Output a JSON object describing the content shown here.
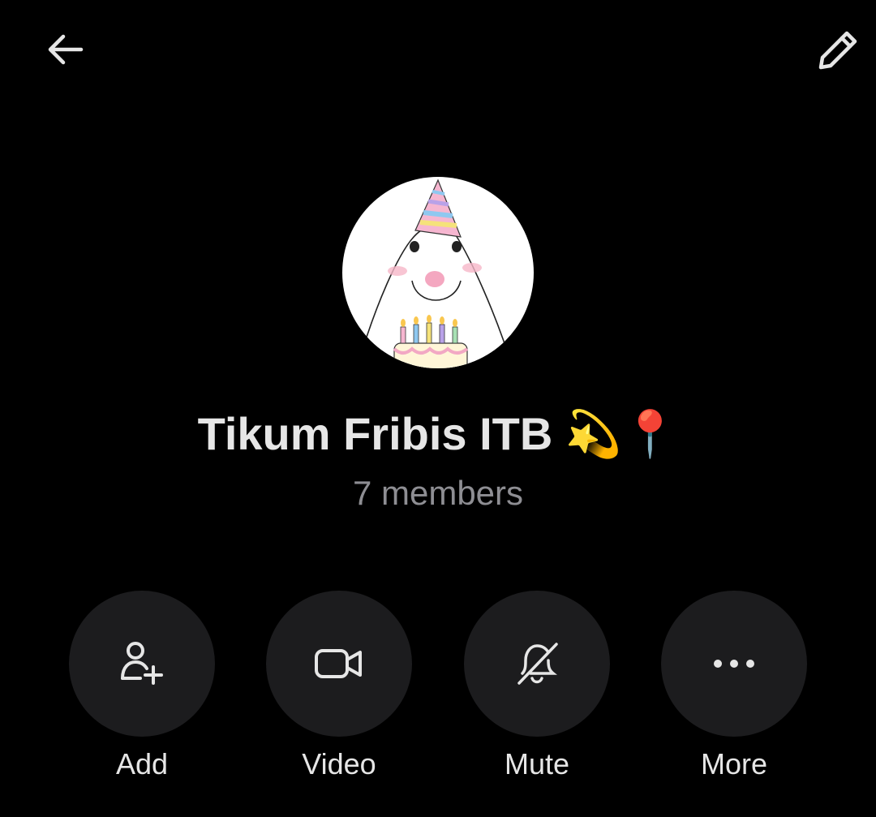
{
  "header": {
    "back_icon": "arrow-left-icon",
    "edit_icon": "pencil-icon"
  },
  "group": {
    "name": "Tikum Fribis ITB",
    "name_emoji": "💫📍",
    "members": "7 members",
    "avatar_icon": "birthday-ghost-avatar"
  },
  "actions": [
    {
      "label": "Add",
      "icon": "add-user-icon"
    },
    {
      "label": "Video",
      "icon": "video-camera-icon"
    },
    {
      "label": "Mute",
      "icon": "bell-off-icon"
    },
    {
      "label": "More",
      "icon": "more-dots-icon"
    }
  ],
  "colors": {
    "background": "#000000",
    "button_bg": "#1c1c1e",
    "text_primary": "#e6e6e6",
    "text_secondary": "#8e8e93"
  }
}
